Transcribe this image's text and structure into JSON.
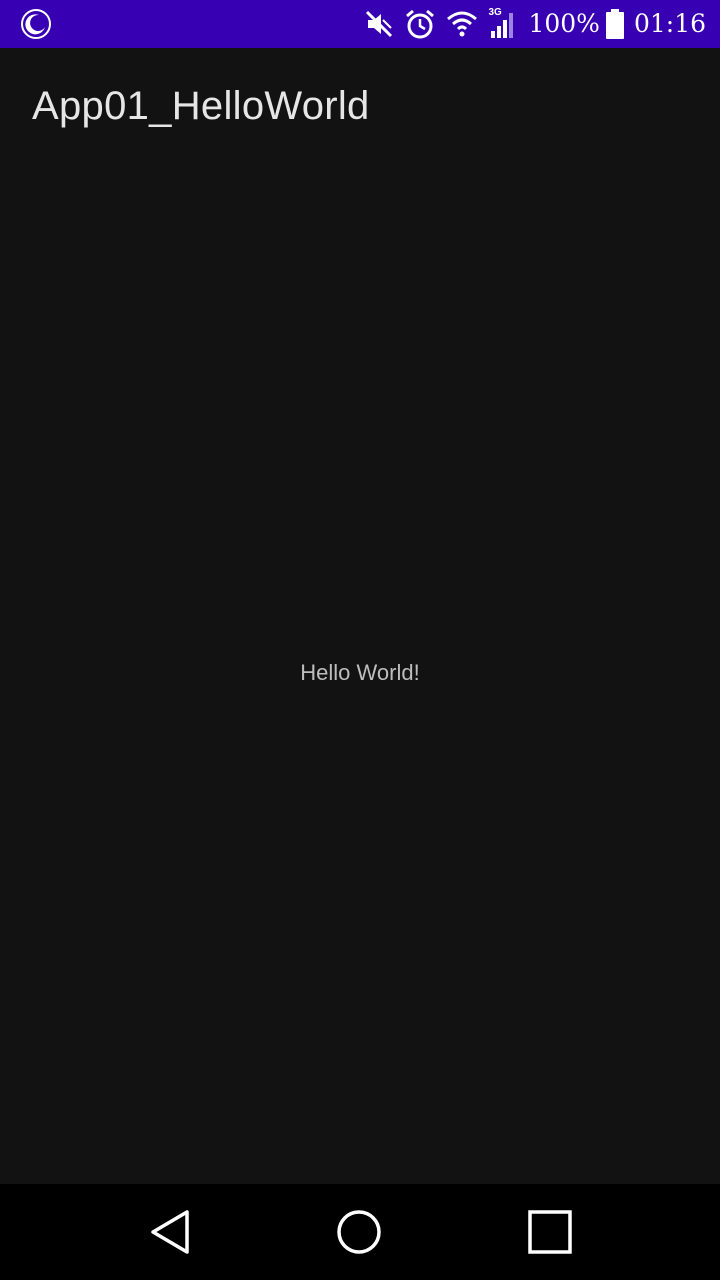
{
  "status_bar": {
    "background": "#3700b3",
    "left_icon": "night-mode-moon-icon",
    "icons": [
      "mute-icon",
      "alarm-icon",
      "wifi-icon",
      "signal-3g-icon"
    ],
    "network_type": "3G",
    "battery_percent_text": "100%",
    "battery_level": 1.0,
    "time": "01:16"
  },
  "app_bar": {
    "title": "App01_HelloWorld"
  },
  "content": {
    "message": "Hello World!"
  },
  "nav_bar": {
    "buttons": [
      "back-icon",
      "home-icon",
      "recents-icon"
    ]
  },
  "colors": {
    "background": "#121212",
    "status_bar": "#3700b3",
    "title_text": "#e6e6e6",
    "body_text": "#bdbdbd",
    "nav_bar": "#000000"
  }
}
